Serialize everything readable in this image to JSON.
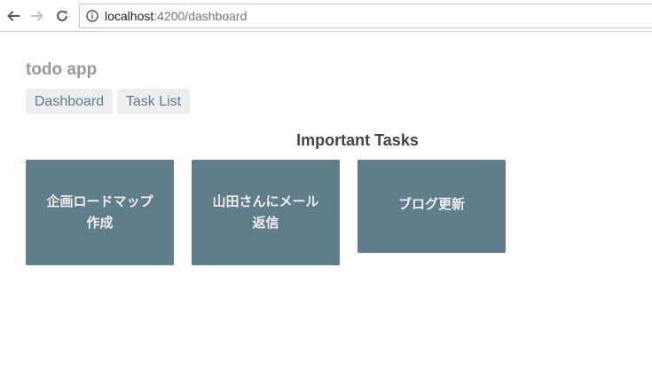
{
  "browser": {
    "url_host": "localhost",
    "url_path": ":4200/dashboard"
  },
  "app": {
    "title": "todo app",
    "nav": [
      {
        "label": "Dashboard"
      },
      {
        "label": "Task List"
      }
    ]
  },
  "dashboard": {
    "heading": "Important Tasks",
    "tasks": [
      {
        "name": "企画ロードマップ作成"
      },
      {
        "name": "山田さんにメール返信"
      },
      {
        "name": "ブログ更新"
      }
    ]
  },
  "colors": {
    "tile_bg": "#607d8b",
    "tile_text": "#eeeeee",
    "nav_bg": "#eeeeee",
    "title_gray": "#999999"
  },
  "icons": [
    "back-arrow-icon",
    "forward-arrow-icon",
    "reload-icon",
    "info-icon"
  ]
}
